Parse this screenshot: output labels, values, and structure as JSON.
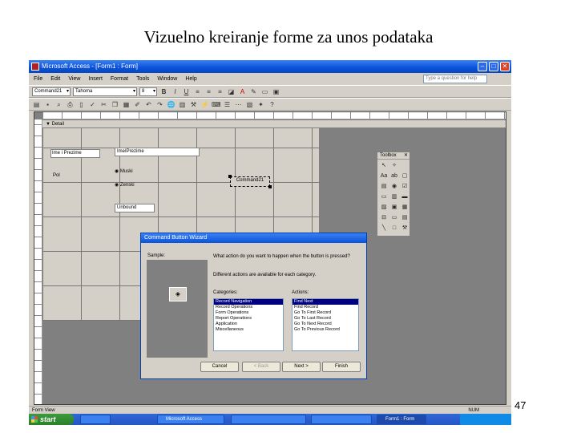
{
  "slide": {
    "title": "Vizuelno kreiranje forme za unos podataka",
    "page_number": "47"
  },
  "window": {
    "title": "Microsoft Access - [Form1 : Form]"
  },
  "menu": [
    "File",
    "Edit",
    "View",
    "Insert",
    "Format",
    "Tools",
    "Window",
    "Help"
  ],
  "help_box": {
    "placeholder": "Type a question for help"
  },
  "toolbar": {
    "object_combo": "Command21",
    "font_combo": "Tahoma",
    "size_combo": "8"
  },
  "form": {
    "section": "Detail",
    "controls": {
      "label1": "Ime i Prezime",
      "text1": "ImeIPrezime",
      "option_label": "Pol",
      "option1": "Muski",
      "option2": "Zenski",
      "combo": "Unbound",
      "command_button": "Command21"
    }
  },
  "toolbox": {
    "title": "Toolbox"
  },
  "wizard": {
    "title": "Command Button Wizard",
    "sample_label": "Sample:",
    "question": "What action do you want to happen when the button is pressed?",
    "hint": "Different actions are available for each category.",
    "categories_label": "Categories:",
    "actions_label": "Actions:",
    "categories": [
      "Record Navigation",
      "Record Operations",
      "Form Operations",
      "Report Operations",
      "Application",
      "Miscellaneous"
    ],
    "actions": [
      "Find Next",
      "Find Record",
      "Go To First Record",
      "Go To Last Record",
      "Go To Next Record",
      "Go To Previous Record"
    ],
    "buttons": {
      "cancel": "Cancel",
      "back": "< Back",
      "next": "Next >",
      "finish": "Finish"
    }
  },
  "status": {
    "left": "Form View",
    "right": "NUM"
  },
  "taskbar": {
    "start": "start",
    "tasks": [
      "",
      "Microsoft Access",
      "",
      "",
      "Form1 : Form"
    ],
    "clock": ""
  }
}
